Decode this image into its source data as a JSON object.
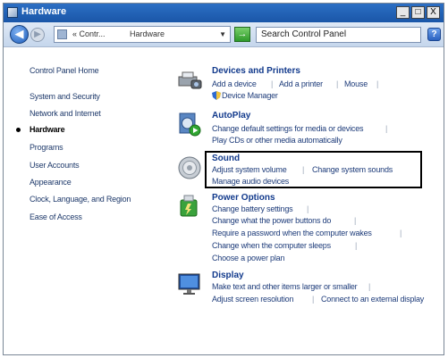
{
  "window": {
    "title": "Hardware",
    "buttons": {
      "minimize": "_",
      "maximize": "□",
      "close": "X"
    }
  },
  "nav": {
    "breadcrumb": [
      "« Contr...",
      "Hardware"
    ],
    "search_placeholder": "Search Control Panel"
  },
  "sidebar": {
    "items": [
      {
        "label": "Control Panel Home",
        "current": false
      },
      {
        "label": "System and Security",
        "current": false
      },
      {
        "label": "Network and Internet",
        "current": false
      },
      {
        "label": "Hardware",
        "current": true
      },
      {
        "label": "Programs",
        "current": false
      },
      {
        "label": "User Accounts",
        "current": false
      },
      {
        "label": "Appearance",
        "current": false
      },
      {
        "label": "Clock, Language, and Region",
        "current": false
      },
      {
        "label": "Ease of Access",
        "current": false
      }
    ]
  },
  "sections": {
    "devices": {
      "title": "Devices and Printers",
      "links": [
        "Add a device",
        "Add a printer",
        "Mouse",
        "Device Manager"
      ]
    },
    "autoplay": {
      "title": "AutoPlay",
      "links": [
        "Change default settings for media or devices",
        "Play CDs or other media automatically"
      ]
    },
    "sound": {
      "title": "Sound",
      "links": [
        "Adjust system volume",
        "Change system sounds",
        "Manage audio devices"
      ]
    },
    "power": {
      "title": "Power Options",
      "links": [
        "Change battery settings",
        "Change what the power buttons do",
        "Require a password when the computer wakes",
        "Change when the computer sleeps",
        "Choose a power plan"
      ]
    },
    "display": {
      "title": "Display",
      "links": [
        "Make text and other items larger or smaller",
        "Adjust screen resolution",
        "Connect to an external display"
      ]
    }
  },
  "icons": {
    "devices": "printer-camera-icon",
    "autoplay": "autoplay-icon",
    "sound": "speaker-icon",
    "power": "power-options-icon",
    "display": "monitor-icon",
    "search": "search-icon"
  },
  "colors": {
    "titlebar": "#1a56a8",
    "link": "#1e3c7a",
    "heading": "#123a8c",
    "highlight_box": "#000000"
  }
}
